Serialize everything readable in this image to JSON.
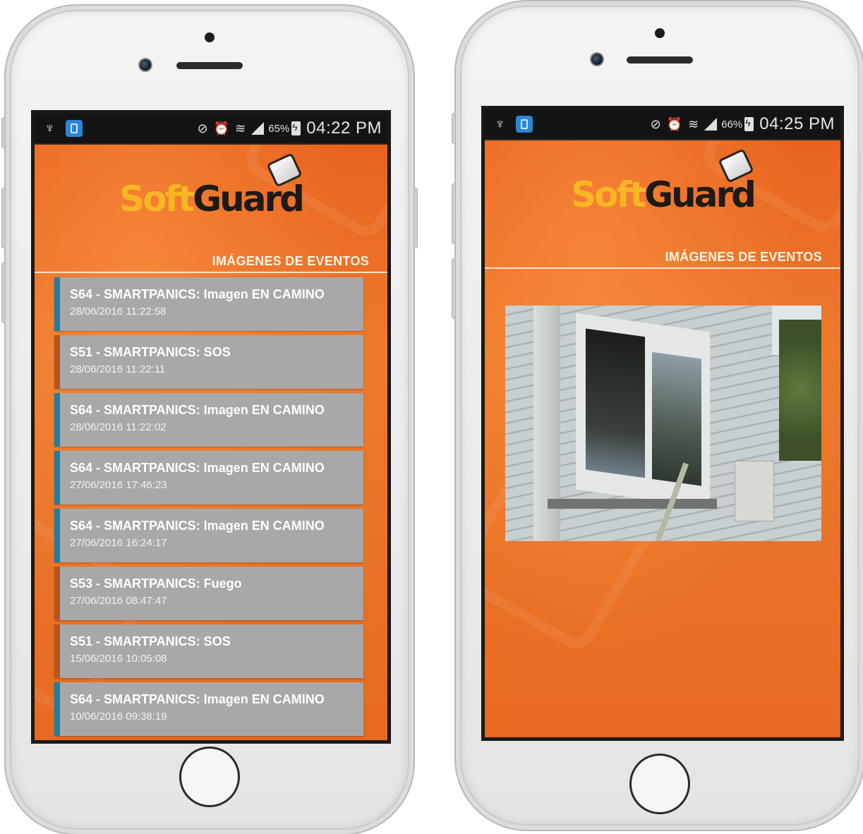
{
  "colors": {
    "app_orange": "#e8631e",
    "logo_soft": "#f8b624",
    "logo_guard": "#1e1a16",
    "item_bg": "#a8a8a8",
    "accent_blue": "#1f7ea3",
    "accent_orange": "#b7551c"
  },
  "left_phone": {
    "status": {
      "usb_icon": "usb-icon",
      "battery_pct": "65%",
      "time": "04:22 PM"
    },
    "logo": {
      "soft": "Soft",
      "guard": "Guard"
    },
    "section_title": "IMÁGENES DE EVENTOS",
    "events": [
      {
        "title": "S64 - SMARTPANICS: Imagen EN CAMINO",
        "date": "28/06/2016 11:22:58",
        "accent": "blue"
      },
      {
        "title": "S51 - SMARTPANICS: SOS",
        "date": "28/06/2016 11:22:11",
        "accent": "orange"
      },
      {
        "title": "S64 - SMARTPANICS: Imagen EN CAMINO",
        "date": "28/06/2016 11:22:02",
        "accent": "blue"
      },
      {
        "title": "S64 - SMARTPANICS: Imagen EN CAMINO",
        "date": "27/06/2016 17:46:23",
        "accent": "blue"
      },
      {
        "title": "S64 - SMARTPANICS: Imagen EN CAMINO",
        "date": "27/06/2016 16:24:17",
        "accent": "blue"
      },
      {
        "title": "S53 - SMARTPANICS: Fuego",
        "date": "27/06/2016 08:47:47",
        "accent": "orange"
      },
      {
        "title": "S51 - SMARTPANICS: SOS",
        "date": "15/06/2016 10:05:08",
        "accent": "orange"
      },
      {
        "title": "S64 - SMARTPANICS: Imagen EN CAMINO",
        "date": "10/06/2016 09:38:19",
        "accent": "blue"
      }
    ]
  },
  "right_phone": {
    "status": {
      "battery_pct": "66%",
      "time": "04:25 PM"
    },
    "logo": {
      "soft": "Soft",
      "guard": "Guard"
    },
    "section_title": "IMÁGENES DE EVENTOS",
    "photo": {
      "subject": "broken-window-photo"
    }
  }
}
